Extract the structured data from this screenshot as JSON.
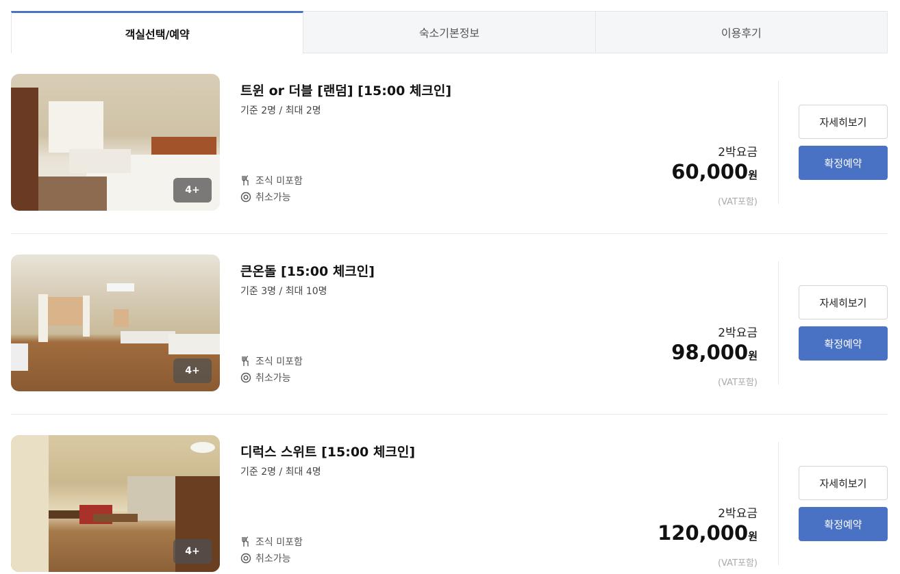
{
  "tabs": [
    {
      "label": "객실선택/예약",
      "active": true
    },
    {
      "label": "숙소기본정보",
      "active": false
    },
    {
      "label": "이용후기",
      "active": false
    }
  ],
  "rooms": [
    {
      "title": "트윈 or 더블 [랜덤] [15:00 체크인]",
      "capacity": "기준 2명 / 최대 2명",
      "photo_count": "4+",
      "breakfast": "조식 미포함",
      "cancel": "취소가능",
      "price_label": "2박요금",
      "price": "60,000",
      "price_unit": "원",
      "vat": "(VAT포함)",
      "detail_label": "자세히보기",
      "book_label": "확정예약"
    },
    {
      "title": "큰온돌 [15:00 체크인]",
      "capacity": "기준 3명 / 최대 10명",
      "photo_count": "4+",
      "breakfast": "조식 미포함",
      "cancel": "취소가능",
      "price_label": "2박요금",
      "price": "98,000",
      "price_unit": "원",
      "vat": "(VAT포함)",
      "detail_label": "자세히보기",
      "book_label": "확정예약"
    },
    {
      "title": "디럭스 스위트 [15:00 체크인]",
      "capacity": "기준 2명 / 최대 4명",
      "photo_count": "4+",
      "breakfast": "조식 미포함",
      "cancel": "취소가능",
      "price_label": "2박요금",
      "price": "120,000",
      "price_unit": "원",
      "vat": "(VAT포함)",
      "detail_label": "자세히보기",
      "book_label": "확정예약"
    }
  ],
  "colors": {
    "accent": "#4a72c4",
    "tab_bg": "#f5f6f8",
    "muted_text": "#aaaaaa"
  },
  "icons": {
    "breakfast": "fork-knife-icon",
    "cancel": "circle-target-icon"
  }
}
